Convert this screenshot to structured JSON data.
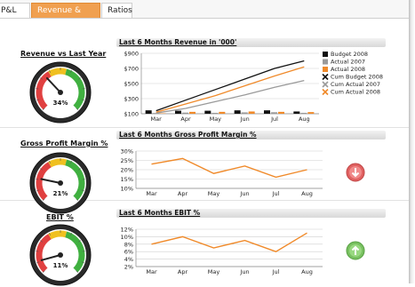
{
  "tabs": [
    {
      "label": "P&L"
    },
    {
      "label": "Revenue & Profit"
    },
    {
      "label": "Ratios"
    }
  ],
  "colors": {
    "accent": "#f0a050",
    "budget": "#111111",
    "actual2007": "#9a9a9a",
    "actual2008": "#f08a2a",
    "down_indicator": "#e06060",
    "up_indicator": "#78c060"
  },
  "gauges": [
    {
      "title": "Revenue vs Last Year",
      "value_label": "34%",
      "value": 34
    },
    {
      "title": "Gross Profit Margin %",
      "value_label": "21%",
      "value": 21
    },
    {
      "title": "EBIT %",
      "value_label": "11%",
      "value": 11
    }
  ],
  "indicators": {
    "gross_profit": "arrow-down-icon",
    "ebit": "arrow-up-icon"
  },
  "chart_data": [
    {
      "type": "bar",
      "title": "Last 6 Months Revenue in '000'",
      "categories": [
        "Mar",
        "Apr",
        "May",
        "Jun",
        "Jul",
        "Aug"
      ],
      "ylim": [
        100,
        900
      ],
      "yticks": [
        100,
        300,
        500,
        700,
        900
      ],
      "ytick_labels": [
        "$100",
        "$300",
        "$500",
        "$700",
        "$900"
      ],
      "grid": true,
      "legend": "right",
      "series": [
        {
          "name": "Budget 2008",
          "kind": "bar",
          "color": "#111111",
          "values": [
            145,
            140,
            140,
            145,
            145,
            130
          ]
        },
        {
          "name": "Actual 2007",
          "kind": "bar",
          "color": "#9a9a9a",
          "values": [
            110,
            115,
            112,
            118,
            120,
            112
          ]
        },
        {
          "name": "Actual 2008",
          "kind": "bar",
          "color": "#f08a2a",
          "values": [
            105,
            125,
            125,
            130,
            125,
            122
          ]
        },
        {
          "name": "Cum Budget 2008",
          "kind": "line",
          "color": "#111111",
          "values": [
            140,
            280,
            420,
            560,
            700,
            800
          ]
        },
        {
          "name": "Cum Actual 2007",
          "kind": "line",
          "color": "#9a9a9a",
          "values": [
            110,
            170,
            260,
            350,
            450,
            540
          ]
        },
        {
          "name": "Cum Actual 2008",
          "kind": "line",
          "color": "#f08a2a",
          "values": [
            120,
            230,
            340,
            470,
            600,
            720
          ]
        }
      ]
    },
    {
      "type": "line",
      "title": "Last 6 Months Gross Profit Margin %",
      "categories": [
        "Mar",
        "Apr",
        "May",
        "Jun",
        "Jul",
        "Aug"
      ],
      "ylim": [
        10,
        30
      ],
      "yticks": [
        10,
        15,
        20,
        25,
        30
      ],
      "ytick_labels": [
        "10%",
        "15%",
        "20%",
        "25%",
        "30%"
      ],
      "grid": true,
      "series": [
        {
          "color": "#f08a2a",
          "values": [
            23,
            26,
            18,
            22,
            16,
            20
          ]
        }
      ]
    },
    {
      "type": "line",
      "title": "Last 6 Months EBIT %",
      "categories": [
        "Mar",
        "Apr",
        "May",
        "Jun",
        "Jul",
        "Aug"
      ],
      "ylim": [
        2,
        12
      ],
      "yticks": [
        2,
        4,
        6,
        8,
        10,
        12
      ],
      "ytick_labels": [
        "2%",
        "4%",
        "6%",
        "8%",
        "10%",
        "12%"
      ],
      "grid": true,
      "series": [
        {
          "color": "#f08a2a",
          "values": [
            8,
            10,
            7,
            9,
            6,
            11
          ]
        }
      ]
    }
  ]
}
